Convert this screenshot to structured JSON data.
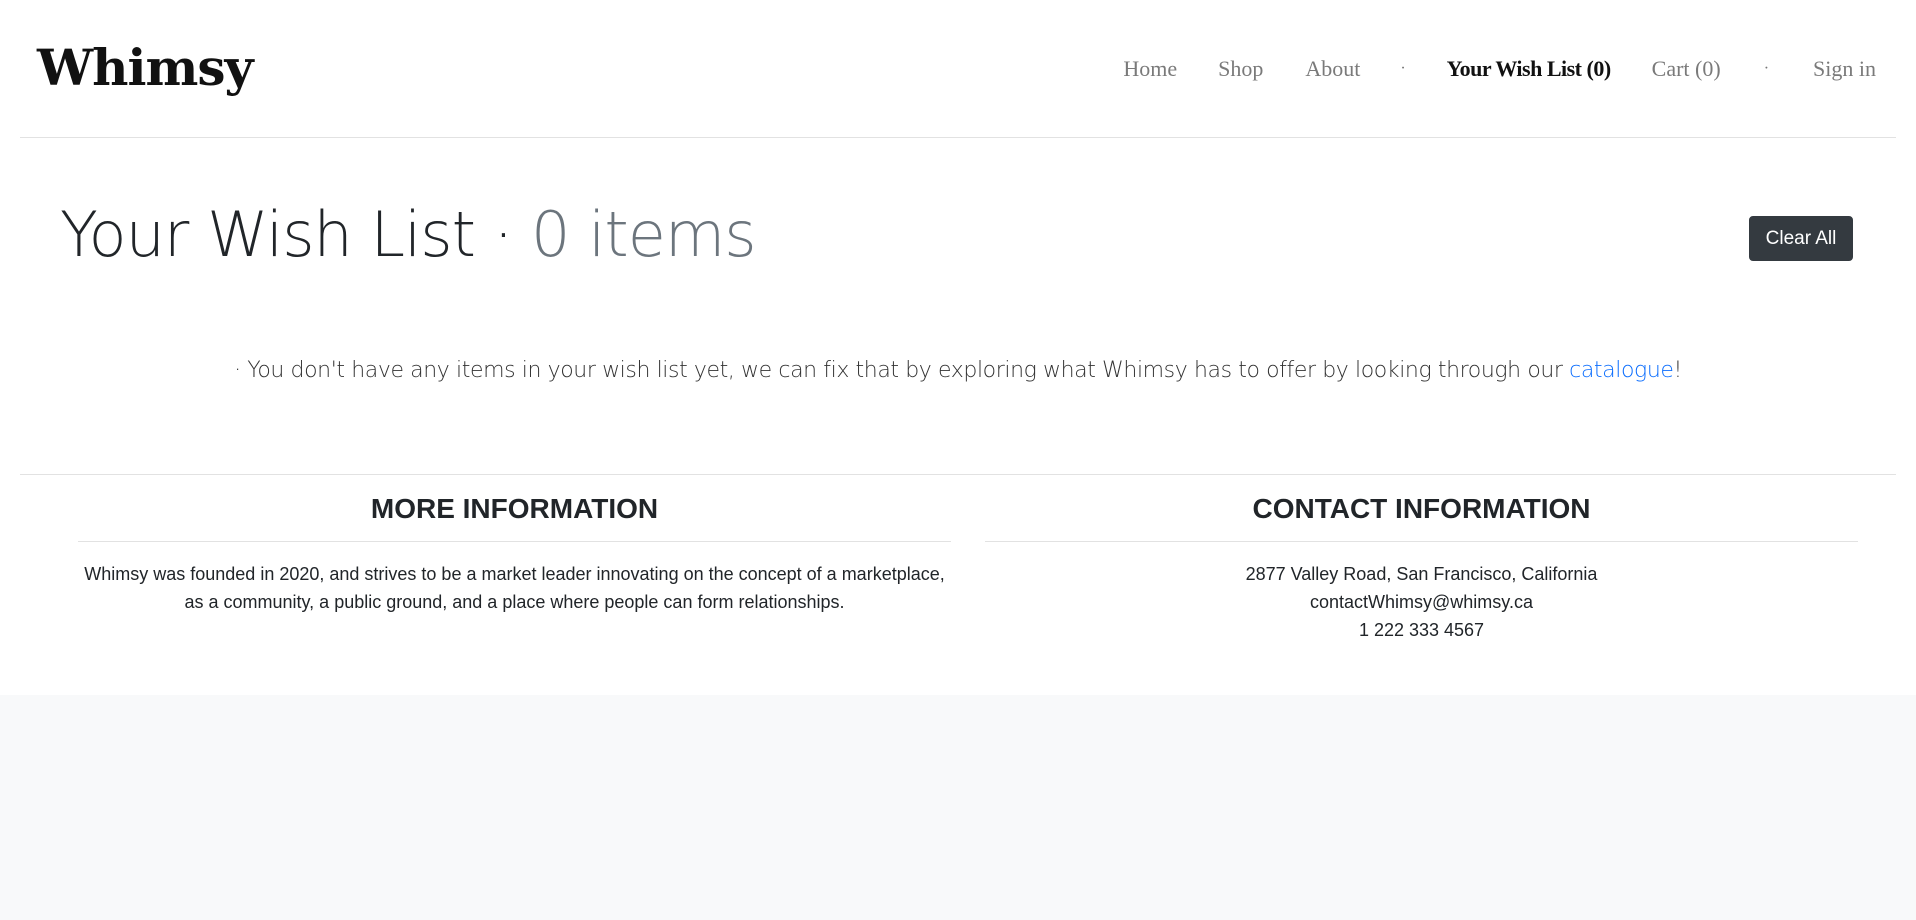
{
  "brand": "Whimsy",
  "nav": {
    "home": "Home",
    "shop": "Shop",
    "about": "About",
    "sep": "·",
    "wishlist": "Your Wish List (0)",
    "cart": "Cart (0)",
    "signin": "Sign in"
  },
  "main": {
    "title": "Your Wish List",
    "title_sep": " · ",
    "count": "0 items",
    "clear_label": "Clear All",
    "empty_prefix": "· You don't have any items in your wish list yet, we can fix that by exploring what Whimsy has to offer by looking through our ",
    "empty_link": "catalogue",
    "empty_suffix": "!"
  },
  "footer": {
    "more": {
      "heading": "MORE INFORMATION",
      "text": "Whimsy was founded in 2020, and strives to be a market leader innovating on the concept of a marketplace, as a community, a public ground, and a place where people can form relationships."
    },
    "contact": {
      "heading": "CONTACT INFORMATION",
      "address": "2877 Valley Road, San Francisco, California",
      "email": "contactWhimsy@whimsy.ca",
      "phone": "1 222 333 4567"
    }
  },
  "colors": {
    "accent_link": "#0d6efd",
    "button_bg": "#343a40",
    "page_bg": "#f8f9fa"
  }
}
